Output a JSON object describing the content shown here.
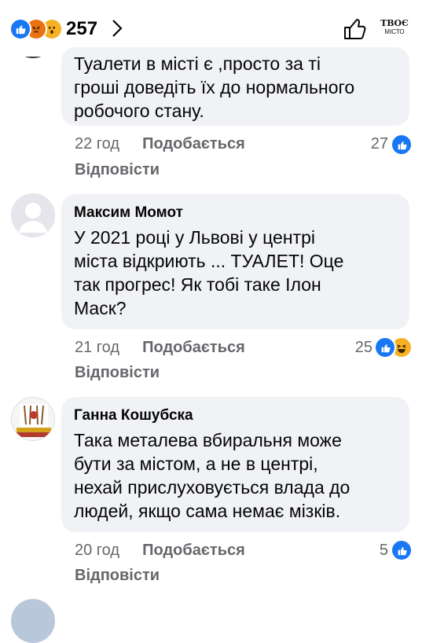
{
  "header": {
    "reaction_count": "257",
    "reactions": [
      "like-icon",
      "angry-icon",
      "wow-icon"
    ],
    "brand_line1": "ТВОЄ",
    "brand_line2": "МІСТО"
  },
  "comments": [
    {
      "author": "",
      "text_lines": [
        "Туалети в місті є ,просто за ті",
        "гроші доведіть їх до нормального",
        "робочого стану."
      ],
      "time": "22 год",
      "like_label": "Подобається",
      "reply_label": "Відповісти",
      "reaction_count": "27",
      "reactions": [
        "like-icon"
      ]
    },
    {
      "author": "Максим Момот",
      "text_lines": [
        "У 2021 році у Львові у центрі",
        "міста відкриють ... ТУАЛЕТ! Оце",
        "так прогрес! Як тобі таке Ілон",
        "Маск?"
      ],
      "time": "21 год",
      "like_label": "Подобається",
      "reply_label": "Відповісти",
      "reaction_count": "25",
      "reactions": [
        "like-icon",
        "haha-icon"
      ]
    },
    {
      "author": "Ганна Кошубска",
      "text_lines": [
        "Така  металева вбиральня може",
        "бути за містом,  а не в центрі,",
        "нехай прислуховується влада до",
        "людей, якщо сама немає мізків."
      ],
      "time": "20 год",
      "like_label": "Подобається",
      "reply_label": "Відповісти",
      "reaction_count": "5",
      "reactions": [
        "like-icon"
      ]
    }
  ],
  "colors": {
    "bubble": "#f0f2f5",
    "meta_text": "#65676b",
    "like_blue": "#1877f2"
  }
}
